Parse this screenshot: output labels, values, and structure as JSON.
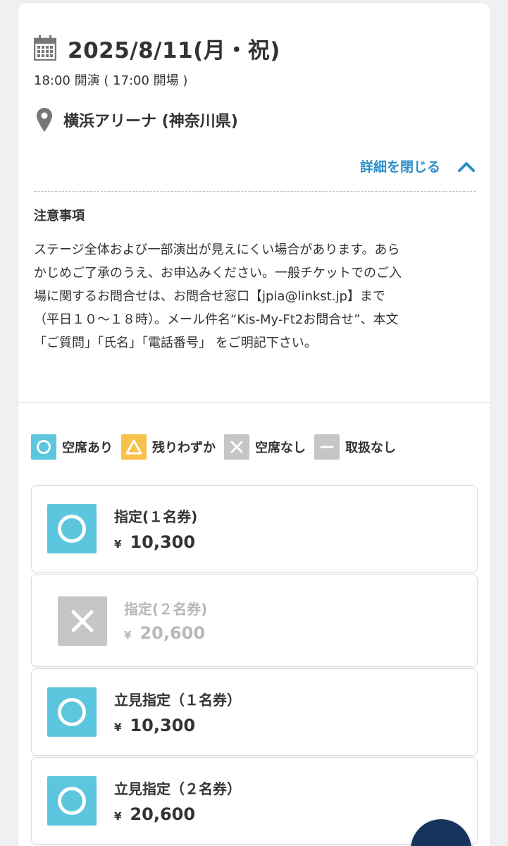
{
  "event": {
    "date": "2025/8/11(月・祝)",
    "time": "18:00 開演 ( 17:00 開場 )",
    "venue": "横浜アリーナ (神奈川県)"
  },
  "details_toggle": {
    "label": "詳細を閉じる"
  },
  "notes": {
    "title": "注意事項",
    "lines": [
      "ステージ全体および一部演出が見えにくい場合があります。あら",
      "かじめご了承のうえ、お申込みください。一般チケットでのご入",
      "場に関するお問合せは、お問合せ窓口【jpia@linkst.jp】まで",
      "（平日１０～１８時）。メール件名“Kis-My-Ft2お問合せ”、本文",
      "「ご質問」「氏名」「電話番号」 をご明記下さい。"
    ]
  },
  "legend": [
    {
      "label": "空席あり",
      "icon": "circle-icon",
      "color": "#5bc6de"
    },
    {
      "label": "残りわずか",
      "icon": "triangle-icon",
      "color": "#f8c14a"
    },
    {
      "label": "空席なし",
      "icon": "cross-icon",
      "color": "#c6c6c6"
    },
    {
      "label": "取扱なし",
      "icon": "dash-icon",
      "color": "#c6c6c6"
    }
  ],
  "tickets": [
    {
      "name": "指定(１名券)",
      "currency": "¥",
      "price": "10,300",
      "status": "空席あり"
    },
    {
      "name": "指定(２名券)",
      "currency": "¥",
      "price": "20,600",
      "status": "空席なし"
    },
    {
      "name": "立見指定（１名券）",
      "currency": "¥",
      "price": "10,300",
      "status": "空席あり"
    },
    {
      "name": "立見指定（２名券）",
      "currency": "¥",
      "price": "20,600",
      "status": "空席あり"
    }
  ],
  "colors": {
    "link": "#2a8fc7",
    "available": "#5bc6de",
    "few_left": "#f8c14a",
    "sold_out": "#c6c6c6",
    "fab": "#15345e"
  }
}
